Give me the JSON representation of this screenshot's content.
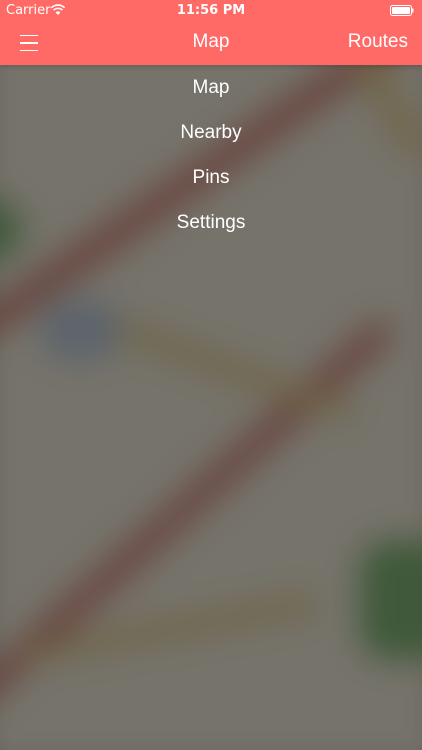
{
  "status_bar": {
    "carrier": "Carrier",
    "time": "11:56 PM",
    "wifi_icon": "wifi-icon",
    "battery_icon": "battery-icon"
  },
  "nav_bar": {
    "title": "Map",
    "menu_icon": "hamburger-menu-icon",
    "right_button": "Routes"
  },
  "menu": {
    "items": [
      {
        "label": "Map"
      },
      {
        "label": "Nearby"
      },
      {
        "label": "Pins"
      },
      {
        "label": "Settings"
      }
    ]
  },
  "colors": {
    "header": "#FF6A66",
    "text": "#FFFFFF",
    "overlay": "#3A3834"
  }
}
